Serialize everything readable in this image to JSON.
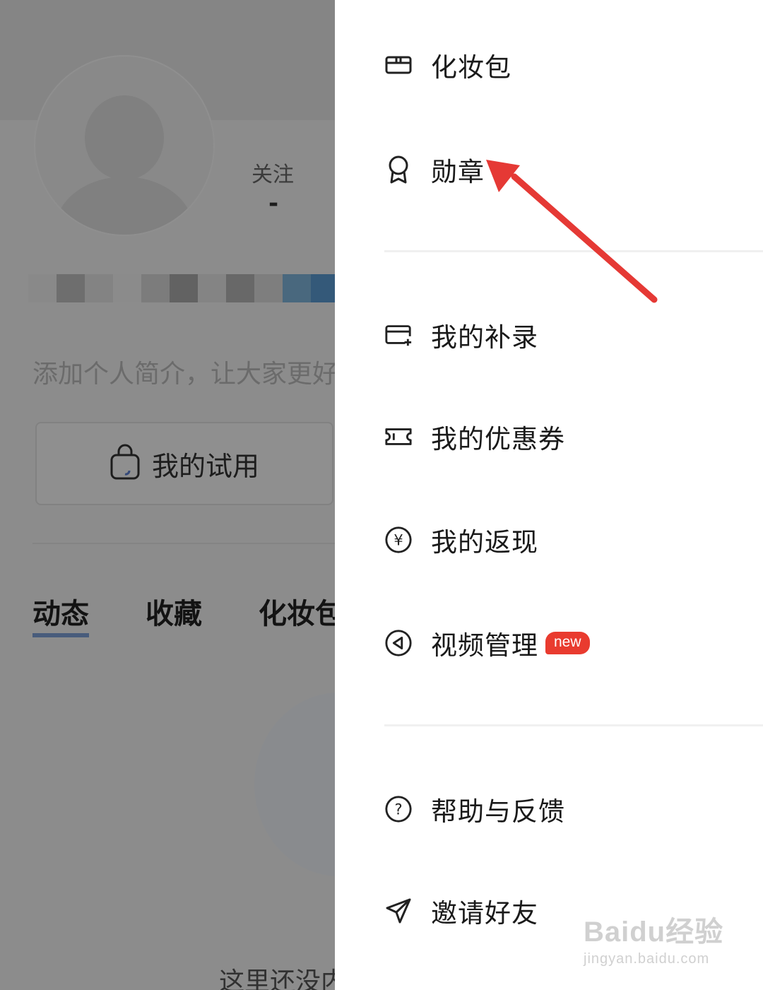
{
  "profile": {
    "follow_label": "关注",
    "follow_value": "-",
    "bio_placeholder": "添加个人简介，让大家更好",
    "trial_button": "我的试用",
    "tabs": [
      "动态",
      "收藏",
      "化妆包"
    ],
    "empty_text": "这里还没内容"
  },
  "drawer": {
    "items": [
      {
        "label": "化妆包",
        "icon": "makeup-bag-icon"
      },
      {
        "label": "勋章",
        "icon": "medal-icon"
      },
      {
        "label": "我的补录",
        "icon": "card-add-icon"
      },
      {
        "label": "我的优惠券",
        "icon": "coupon-icon"
      },
      {
        "label": "我的返现",
        "icon": "yen-circle-icon"
      },
      {
        "label": "视频管理",
        "icon": "play-circle-icon",
        "badge": "new"
      },
      {
        "label": "帮助与反馈",
        "icon": "question-circle-icon"
      },
      {
        "label": "邀请好友",
        "icon": "paper-plane-icon"
      }
    ]
  },
  "watermark": {
    "main": "Baidu经验",
    "sub": "jingyan.baidu.com"
  },
  "colors": {
    "accent_red": "#e93b2f",
    "annotation_arrow": "#e53935",
    "tab_underline": "#7d9fd6"
  }
}
